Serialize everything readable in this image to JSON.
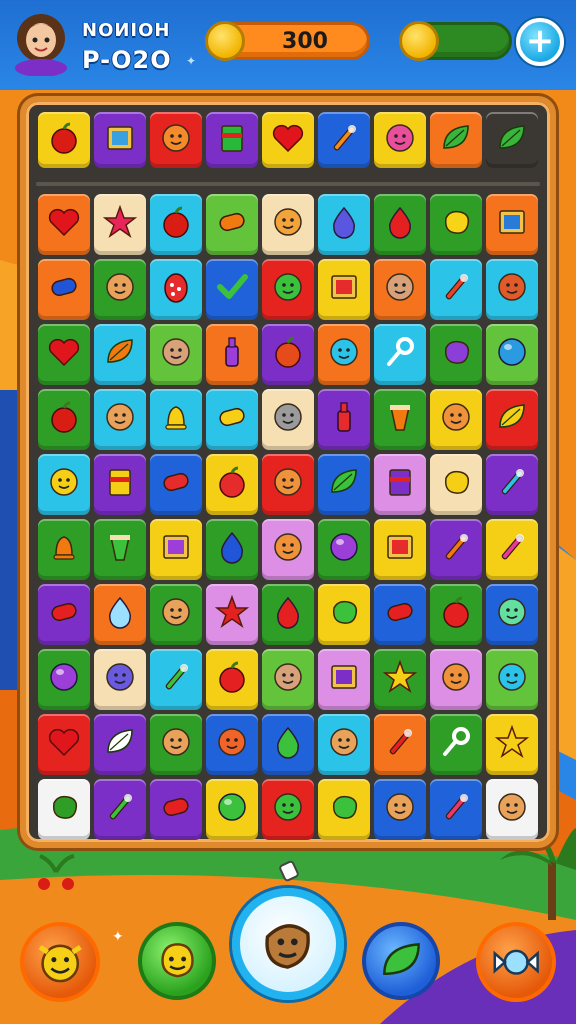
{
  "player": {
    "name": "NOИIOH",
    "level": "P-O2O"
  },
  "currency": {
    "coins": "300",
    "energy_level": 1.0
  },
  "colors": {
    "red": "#e5231f",
    "orange": "#f5731c",
    "yellow": "#f4cf15",
    "green": "#2f9e27",
    "lime": "#63c33b",
    "cyan": "#2cc3e8",
    "blue": "#1f62d9",
    "purple": "#7b2fc7",
    "pink": "#dd8fe6",
    "cream": "#f6dfb3",
    "white": "#f4f4f4"
  },
  "goal_tiles": [
    {
      "bg": "yellow",
      "icon": "apple",
      "color": "#d91d14"
    },
    {
      "bg": "purple",
      "icon": "picture",
      "color": "#3aa1e0"
    },
    {
      "bg": "red",
      "icon": "face",
      "color": "#f58a2a"
    },
    {
      "bg": "purple",
      "icon": "book",
      "color": "#28b83a"
    },
    {
      "bg": "yellow",
      "icon": "heart",
      "color": "#e0161c"
    },
    {
      "bg": "blue",
      "icon": "wand",
      "color": "#f28c1e"
    },
    {
      "bg": "yellow",
      "icon": "face",
      "color": "#e94f9a"
    },
    {
      "bg": "orange",
      "icon": "leaf",
      "color": "#38b53a"
    },
    {
      "bg": "dark",
      "icon": "leaf",
      "color": "#38b53a"
    }
  ],
  "board_rows": [
    [
      {
        "bg": "orange",
        "icon": "heart",
        "color": "#e0161c"
      },
      {
        "bg": "cream",
        "icon": "star",
        "color": "#e8245a"
      },
      {
        "bg": "cyan",
        "icon": "apple",
        "color": "#d91d14"
      },
      {
        "bg": "lime",
        "icon": "pill",
        "color": "#f07a10"
      },
      {
        "bg": "cream",
        "icon": "face",
        "color": "#f2a33a"
      },
      {
        "bg": "cyan",
        "icon": "drop",
        "color": "#5a56e0"
      },
      {
        "bg": "green",
        "icon": "drop",
        "color": "#e52020"
      },
      {
        "bg": "green",
        "icon": "blob",
        "color": "#f8d418"
      },
      {
        "bg": "orange",
        "icon": "picture",
        "color": "#2a7ad8"
      }
    ],
    [
      {
        "bg": "orange",
        "icon": "pill",
        "color": "#1f55d6"
      },
      {
        "bg": "green",
        "icon": "face",
        "color": "#e8a25a"
      },
      {
        "bg": "cyan",
        "icon": "egg",
        "color": "#e52b2b"
      },
      {
        "bg": "blue",
        "icon": "check",
        "color": "#3bc13b"
      },
      {
        "bg": "red",
        "icon": "face",
        "color": "#3bc13b"
      },
      {
        "bg": "yellow",
        "icon": "picture",
        "color": "#e52b2b"
      },
      {
        "bg": "orange",
        "icon": "face",
        "color": "#d7a27a"
      },
      {
        "bg": "cyan",
        "icon": "wand",
        "color": "#e5432b"
      },
      {
        "bg": "cyan",
        "icon": "face",
        "color": "#e05a2a"
      }
    ],
    [
      {
        "bg": "green",
        "icon": "heart",
        "color": "#e0161c"
      },
      {
        "bg": "cyan",
        "icon": "leaf",
        "color": "#f07a10"
      },
      {
        "bg": "lime",
        "icon": "face",
        "color": "#d7a27a"
      },
      {
        "bg": "orange",
        "icon": "bottle",
        "color": "#9b3fd8"
      },
      {
        "bg": "purple",
        "icon": "apple",
        "color": "#e54b1b"
      },
      {
        "bg": "orange",
        "icon": "face",
        "color": "#2cc3e8"
      },
      {
        "bg": "cyan",
        "icon": "key",
        "color": "#ffffff"
      },
      {
        "bg": "green",
        "icon": "blob",
        "color": "#8b3fd8"
      },
      {
        "bg": "lime",
        "icon": "ball",
        "color": "#2a9be0"
      }
    ],
    [
      {
        "bg": "green",
        "icon": "apple",
        "color": "#d91d14"
      },
      {
        "bg": "cyan",
        "icon": "face",
        "color": "#e8a25a"
      },
      {
        "bg": "cyan",
        "icon": "bell",
        "color": "#f4cf15"
      },
      {
        "bg": "cyan",
        "icon": "pill",
        "color": "#f4cf15"
      },
      {
        "bg": "cream",
        "icon": "face",
        "color": "#9b9b9b"
      },
      {
        "bg": "purple",
        "icon": "bottle",
        "color": "#e52b2b"
      },
      {
        "bg": "green",
        "icon": "cup",
        "color": "#f07a10"
      },
      {
        "bg": "yellow",
        "icon": "face",
        "color": "#f0923a"
      },
      {
        "bg": "red",
        "icon": "leaf",
        "color": "#f4cf15"
      }
    ],
    [
      {
        "bg": "cyan",
        "icon": "face",
        "color": "#f4cf15"
      },
      {
        "bg": "purple",
        "icon": "book",
        "color": "#f4cf15"
      },
      {
        "bg": "blue",
        "icon": "pill",
        "color": "#e52b2b"
      },
      {
        "bg": "yellow",
        "icon": "apple",
        "color": "#e52b2b"
      },
      {
        "bg": "red",
        "icon": "face",
        "color": "#f0923a"
      },
      {
        "bg": "blue",
        "icon": "leaf",
        "color": "#3bc13b"
      },
      {
        "bg": "pink",
        "icon": "book",
        "color": "#7b2fc7"
      },
      {
        "bg": "cream",
        "icon": "blob",
        "color": "#f4cf15"
      },
      {
        "bg": "purple",
        "icon": "wand",
        "color": "#2cc3e8"
      }
    ],
    [
      {
        "bg": "green",
        "icon": "bell",
        "color": "#f07a10"
      },
      {
        "bg": "green",
        "icon": "cup",
        "color": "#3bc13b"
      },
      {
        "bg": "yellow",
        "icon": "picture",
        "color": "#9b3fd8"
      },
      {
        "bg": "green",
        "icon": "drop",
        "color": "#1f55d6"
      },
      {
        "bg": "pink",
        "icon": "face",
        "color": "#f0923a"
      },
      {
        "bg": "green",
        "icon": "ball",
        "color": "#9b3fd8"
      },
      {
        "bg": "yellow",
        "icon": "picture",
        "color": "#e52b2b"
      },
      {
        "bg": "purple",
        "icon": "wand",
        "color": "#f07a10"
      },
      {
        "bg": "yellow",
        "icon": "wand",
        "color": "#e83a9a"
      }
    ],
    [
      {
        "bg": "purple",
        "icon": "pill",
        "color": "#e52020"
      },
      {
        "bg": "orange",
        "icon": "drop",
        "color": "#9be0ff"
      },
      {
        "bg": "green",
        "icon": "face",
        "color": "#e8a25a"
      },
      {
        "bg": "pink",
        "icon": "star",
        "color": "#e52020"
      },
      {
        "bg": "green",
        "icon": "drop",
        "color": "#e52020"
      },
      {
        "bg": "yellow",
        "icon": "blob",
        "color": "#3bc13b"
      },
      {
        "bg": "blue",
        "icon": "pill",
        "color": "#e52020"
      },
      {
        "bg": "green",
        "icon": "apple",
        "color": "#e52020"
      },
      {
        "bg": "blue",
        "icon": "face",
        "color": "#63e0a0"
      }
    ],
    [
      {
        "bg": "green",
        "icon": "ball",
        "color": "#9b3fd8"
      },
      {
        "bg": "cream",
        "icon": "face",
        "color": "#6a5ae0"
      },
      {
        "bg": "cyan",
        "icon": "wand",
        "color": "#3bc13b"
      },
      {
        "bg": "yellow",
        "icon": "apple",
        "color": "#e52020"
      },
      {
        "bg": "lime",
        "icon": "face",
        "color": "#d7a27a"
      },
      {
        "bg": "pink",
        "icon": "picture",
        "color": "#7b2fc7"
      },
      {
        "bg": "green",
        "icon": "star",
        "color": "#f4cf15"
      },
      {
        "bg": "pink",
        "icon": "face",
        "color": "#f0923a"
      },
      {
        "bg": "lime",
        "icon": "face",
        "color": "#2cc3e8"
      }
    ],
    [
      {
        "bg": "red",
        "icon": "heart",
        "color": "#e0161c"
      },
      {
        "bg": "purple",
        "icon": "leaf",
        "color": "#ffffff"
      },
      {
        "bg": "green",
        "icon": "face",
        "color": "#e8a25a"
      },
      {
        "bg": "blue",
        "icon": "face",
        "color": "#f0642a"
      },
      {
        "bg": "blue",
        "icon": "drop",
        "color": "#3bc13b"
      },
      {
        "bg": "cyan",
        "icon": "face",
        "color": "#e8a25a"
      },
      {
        "bg": "orange",
        "icon": "wand",
        "color": "#e52020"
      },
      {
        "bg": "green",
        "icon": "key",
        "color": "#ffffff"
      },
      {
        "bg": "yellow",
        "icon": "star",
        "color": "#f4cf15"
      }
    ],
    [
      {
        "bg": "white",
        "icon": "blob",
        "color": "#2f9e27"
      },
      {
        "bg": "purple",
        "icon": "wand",
        "color": "#3bc13b"
      },
      {
        "bg": "purple",
        "icon": "pill",
        "color": "#e52020"
      },
      {
        "bg": "yellow",
        "icon": "ball",
        "color": "#3bc13b"
      },
      {
        "bg": "red",
        "icon": "face",
        "color": "#3bc13b"
      },
      {
        "bg": "yellow",
        "icon": "blob",
        "color": "#3bc13b"
      },
      {
        "bg": "blue",
        "icon": "face",
        "color": "#e8a25a"
      },
      {
        "bg": "blue",
        "icon": "wand",
        "color": "#e83a6a"
      },
      {
        "bg": "white",
        "icon": "face",
        "color": "#e8a25a"
      }
    ]
  ],
  "bottom_bar": [
    {
      "id": "b-emoji",
      "icon": "smiley-icon",
      "color": "#f6d016"
    },
    {
      "id": "b-green",
      "icon": "face-icon",
      "color": "#f6d016"
    },
    {
      "id": "b-center",
      "icon": "acorn-icon",
      "color": "#b97a3a"
    },
    {
      "id": "b-blue",
      "icon": "leaf-icon",
      "color": "#3bc13b"
    },
    {
      "id": "b-candy",
      "icon": "candy-icon",
      "color": "#9be0ff"
    }
  ]
}
